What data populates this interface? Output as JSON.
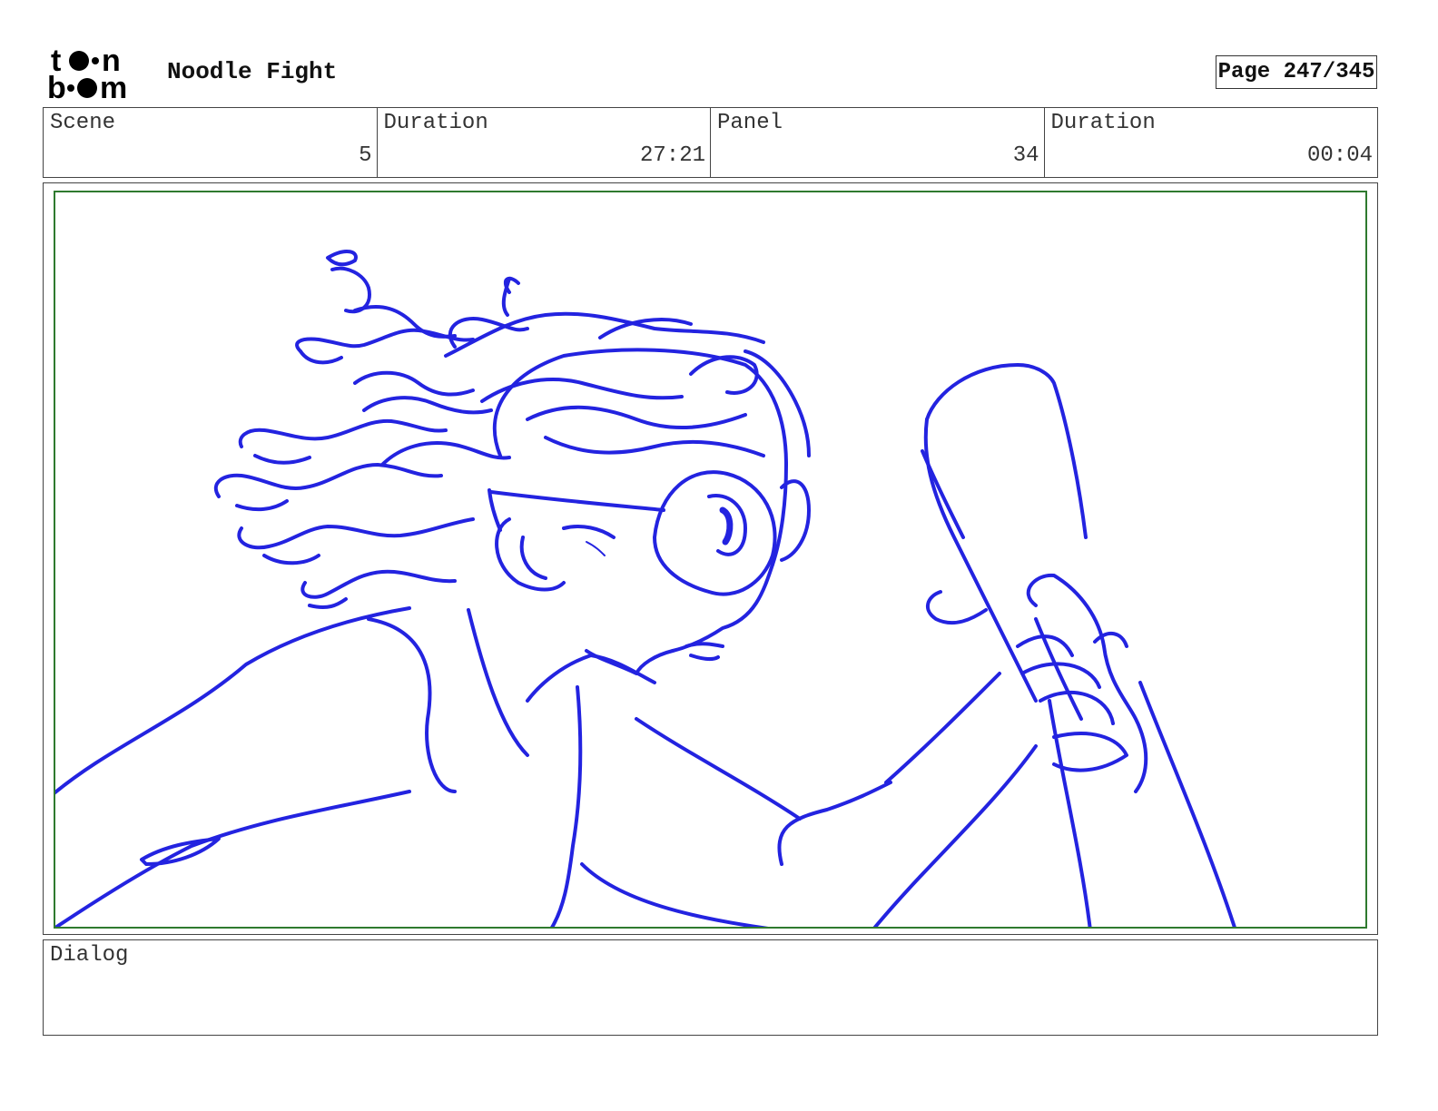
{
  "header": {
    "logo_text": "toon boom",
    "title": "Noodle Fight",
    "page": "Page 247/345"
  },
  "info": {
    "scene_label": "Scene",
    "scene_value": "5",
    "duration_label": "Duration",
    "duration_value": "27:21",
    "panel_label": "Panel",
    "panel_value": "34",
    "panel_duration_label": "Duration",
    "panel_duration_value": "00:04"
  },
  "dialog": {
    "label": "Dialog",
    "text": ""
  },
  "colors": {
    "sketch": "#2323e0",
    "safe_area": "#2f7a2f"
  }
}
